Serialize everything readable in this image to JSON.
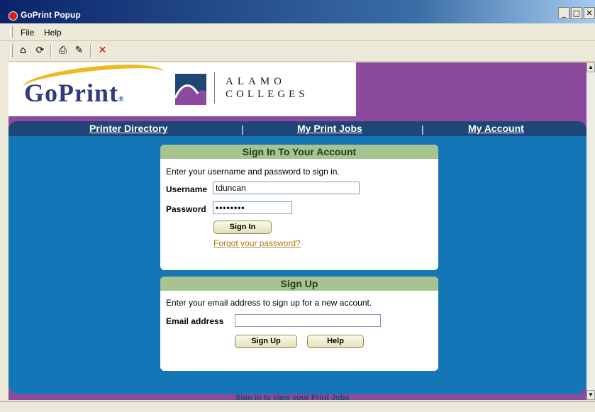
{
  "window": {
    "title": "GoPrint Popup",
    "buttons": {
      "minimize": "_",
      "maximize": "□",
      "close": "✕"
    }
  },
  "menu": {
    "items": [
      "File",
      "Help"
    ]
  },
  "toolbar": {
    "icons": [
      "home-icon",
      "refresh-icon",
      "print-icon",
      "edit-icon",
      "close-icon"
    ],
    "glyphs": [
      "⌂",
      "⟳",
      "⎙",
      "✎",
      "✕"
    ]
  },
  "brand": {
    "goprint": "GoPrint",
    "goprint_reg": "®",
    "alamo_line1": "ALAMO",
    "alamo_line2": "COLLEGES",
    "accent": "#8b4a9e",
    "navy": "#1e4677",
    "blue": "#1475b7"
  },
  "nav": {
    "printer_directory": "Printer Directory",
    "my_print_jobs": "My Print Jobs",
    "my_account": "My Account",
    "separator": "|"
  },
  "signin": {
    "header": "Sign In To Your Account",
    "instructions": "Enter your username and password to sign in.",
    "username_label": "Username",
    "username_value": "tduncan",
    "password_label": "Password",
    "password_value": "••••••••",
    "button": "Sign In",
    "forgot_link": "Forgot your password?"
  },
  "signup": {
    "header": "Sign Up",
    "instructions": "Enter your email address to sign up for a new account.",
    "email_label": "Email address",
    "email_value": "",
    "signup_button": "Sign Up",
    "help_button": "Help"
  },
  "footer": {
    "partial_text": "Sign in to view your Print Jobs"
  }
}
